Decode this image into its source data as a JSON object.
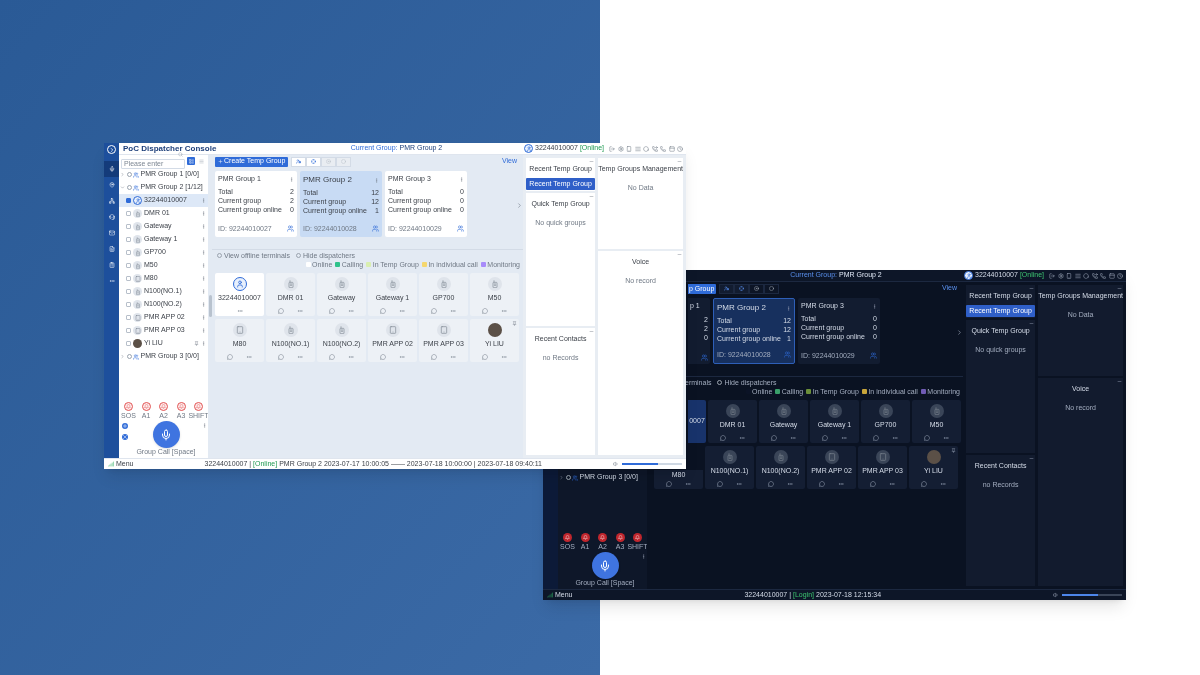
{
  "dark_window": {
    "current_group": {
      "label": "Current Group:",
      "value": "PMR Group 2"
    },
    "user": {
      "number": "32244010007",
      "status": "[Online]"
    },
    "sidebar": {
      "tree": [
        {
          "label": "PMR Group 3 [0/0]",
          "expanded": false,
          "checked": false
        }
      ],
      "emergency": [
        {
          "label": "SOS"
        },
        {
          "label": "A1"
        },
        {
          "label": "A2"
        },
        {
          "label": "A3"
        },
        {
          "label": "SHIFT"
        }
      ],
      "group_call": "Group Call [Space]"
    },
    "toolbar": {
      "create_button": {
        "label": "p Group",
        "kind": "partial"
      },
      "tools": [
        {
          "disabled": false
        },
        {
          "disabled": false
        },
        {
          "disabled": true
        },
        {
          "disabled": true
        }
      ],
      "view_link": "View"
    },
    "cards": [
      {
        "title": "p 1",
        "kind": "partial",
        "selected": false,
        "stats": [
          {
            "value": "2"
          },
          {
            "value": "2"
          },
          {
            "value": "0"
          }
        ]
      },
      {
        "title": "PMR Group 2",
        "kind": "full",
        "selected": true,
        "stats": [
          {
            "label": "Total",
            "value": "12"
          },
          {
            "label": "Current group",
            "value": "12"
          },
          {
            "label": "Current group online",
            "value": "1"
          }
        ],
        "id": "ID: 92244010028"
      },
      {
        "title": "PMR Group 3",
        "kind": "full",
        "selected": false,
        "stats": [
          {
            "label": "Total",
            "value": "0"
          },
          {
            "label": "Current group",
            "value": "0"
          },
          {
            "label": "Current group online",
            "value": "0"
          }
        ],
        "id": "ID: 92244010029"
      }
    ],
    "terminal_options": [
      {
        "label": "erminals",
        "kind": "partial"
      },
      {
        "label": "Hide dispatchers",
        "kind": "full",
        "checked": false
      }
    ],
    "legend": [
      {
        "label": "Online",
        "color": "#0b1326"
      },
      {
        "label": "Calling",
        "color": "#3aa06a"
      },
      {
        "label": "In Temp Group",
        "color": "#6b8f3a"
      },
      {
        "label": "In individual call",
        "color": "#c8a53a"
      },
      {
        "label": "Monitoring",
        "color": "#6f5bb5"
      }
    ],
    "terminals": [
      {
        "name": "0007",
        "kind": "partial",
        "selected": true,
        "pinned": false
      },
      {
        "name": "DMR 01",
        "kind": "radio",
        "selected": false,
        "pinned": false
      },
      {
        "name": "Gateway",
        "kind": "radio",
        "selected": false,
        "pinned": false
      },
      {
        "name": "Gateway 1",
        "kind": "radio",
        "selected": false,
        "pinned": false
      },
      {
        "name": "GP700",
        "kind": "radio",
        "selected": false,
        "pinned": false
      },
      {
        "name": "M50",
        "kind": "radio",
        "selected": false,
        "pinned": false
      },
      {
        "name": "M80",
        "kind": "lower",
        "selected": false,
        "pinned": false
      },
      {
        "name": "N100(NO.1)",
        "kind": "radio",
        "selected": false,
        "pinned": false
      },
      {
        "name": "N100(NO.2)",
        "kind": "radio",
        "selected": false,
        "pinned": false
      },
      {
        "name": "PMR APP 02",
        "kind": "phone",
        "selected": false,
        "pinned": false
      },
      {
        "name": "PMR APP 03",
        "kind": "phone",
        "selected": false,
        "pinned": false
      },
      {
        "name": "Yi LIU",
        "kind": "person",
        "selected": false,
        "pinned": true
      }
    ],
    "panels": {
      "left": [
        {
          "title": "Recent Temp Group",
          "button": "Recent Temp Group"
        },
        {
          "title": "Quick Temp Group",
          "empty": "No quick groups"
        },
        {
          "title": "Recent Contacts",
          "empty": "no Records"
        }
      ],
      "right": [
        {
          "title": "Temp Groups Management",
          "empty": "No Data"
        },
        {
          "title": "Voice",
          "empty": "No record"
        }
      ]
    },
    "status_bar": {
      "menu": "Menu",
      "number": "32244010007 |",
      "state": "[Login]",
      "text": "2023-07-18 12:15:34",
      "volume": {
        "level": 0.6
      }
    }
  },
  "light_window": {
    "app_title": "PoC Dispatcher Console",
    "current_group": {
      "label": "Current Group:",
      "value": "PMR Group 2"
    },
    "user": {
      "number": "32244010007",
      "status": "[Online]"
    },
    "nav_items": [
      {
        "selected": true
      },
      {
        "selected": false
      },
      {
        "selected": false
      },
      {
        "selected": false
      },
      {
        "selected": false
      },
      {
        "selected": false
      },
      {
        "selected": false
      },
      {
        "selected": false
      }
    ],
    "sidebar": {
      "search": {
        "placeholder": "Please enter"
      },
      "view_modes": [
        {
          "selected": true
        },
        {
          "selected": false
        }
      ],
      "tree": [
        {
          "label": "PMR Group 1 [0/0]",
          "expanded": false,
          "checked": false
        },
        {
          "label": "PMR Group 2 [1/12]",
          "expanded": true,
          "checked": false,
          "children": [
            {
              "label": "32244010007",
              "kind": "dispatcher",
              "checked": true,
              "selected": true,
              "pinned": false
            },
            {
              "label": "DMR 01",
              "kind": "radio",
              "checked": false,
              "selected": false,
              "pinned": false
            },
            {
              "label": "Gateway",
              "kind": "radio",
              "checked": false,
              "selected": false,
              "pinned": false
            },
            {
              "label": "Gateway 1",
              "kind": "radio",
              "checked": false,
              "selected": false,
              "pinned": false
            },
            {
              "label": "GP700",
              "kind": "radio",
              "checked": false,
              "selected": false,
              "pinned": false
            },
            {
              "label": "M50",
              "kind": "radio",
              "checked": false,
              "selected": false,
              "pinned": false
            },
            {
              "label": "M80",
              "kind": "phone",
              "checked": false,
              "selected": false,
              "pinned": false
            },
            {
              "label": "N100(NO.1)",
              "kind": "radio",
              "checked": false,
              "selected": false,
              "pinned": false
            },
            {
              "label": "N100(NO.2)",
              "kind": "radio",
              "checked": false,
              "selected": false,
              "pinned": false
            },
            {
              "label": "PMR APP 02",
              "kind": "phone",
              "checked": false,
              "selected": false,
              "pinned": false
            },
            {
              "label": "PMR APP 03",
              "kind": "phone",
              "checked": false,
              "selected": false,
              "pinned": false
            },
            {
              "label": "Yi LIU",
              "kind": "person",
              "checked": false,
              "selected": false,
              "pinned": true
            }
          ]
        },
        {
          "label": "PMR Group 3 [0/0]",
          "expanded": false,
          "checked": false
        }
      ],
      "emergency": [
        {
          "label": "SOS"
        },
        {
          "label": "A1"
        },
        {
          "label": "A2"
        },
        {
          "label": "A3"
        },
        {
          "label": "SHIFT"
        }
      ],
      "group_call": "Group Call [Space]"
    },
    "toolbar": {
      "create_button": {
        "label": "Create Temp Group",
        "kind": "full"
      },
      "tools": [
        {
          "disabled": false
        },
        {
          "disabled": false
        },
        {
          "disabled": true
        },
        {
          "disabled": true
        }
      ],
      "view_link": "View"
    },
    "cards": [
      {
        "title": "PMR Group 1",
        "kind": "full",
        "selected": false,
        "stats": [
          {
            "label": "Total",
            "value": "2"
          },
          {
            "label": "Current group",
            "value": "2"
          },
          {
            "label": "Current group online",
            "value": "0"
          }
        ],
        "id": "ID: 92244010027"
      },
      {
        "title": "PMR Group 2",
        "kind": "full",
        "selected": true,
        "stats": [
          {
            "label": "Total",
            "value": "12"
          },
          {
            "label": "Current group",
            "value": "12"
          },
          {
            "label": "Current group online",
            "value": "1"
          }
        ],
        "id": "ID: 92244010028"
      },
      {
        "title": "PMR Group 3",
        "kind": "full",
        "selected": false,
        "stats": [
          {
            "label": "Total",
            "value": "0"
          },
          {
            "label": "Current group",
            "value": "0"
          },
          {
            "label": "Current group online",
            "value": "0"
          }
        ],
        "id": "ID: 92244010029"
      }
    ],
    "terminal_options": [
      {
        "label": "View offline terminals",
        "kind": "full",
        "checked": false
      },
      {
        "label": "Hide dispatchers",
        "kind": "full",
        "checked": false
      }
    ],
    "legend": [
      {
        "label": "Online",
        "color": "#ffffff"
      },
      {
        "label": "Calling",
        "color": "#2fc28b"
      },
      {
        "label": "In Temp Group",
        "color": "#d9efb0"
      },
      {
        "label": "In individual call",
        "color": "#f5d76e"
      },
      {
        "label": "Monitoring",
        "color": "#a78bfa"
      }
    ],
    "terminals": [
      {
        "name": "32244010007",
        "kind": "dispatcher",
        "selected": true,
        "pinned": false
      },
      {
        "name": "DMR 01",
        "kind": "radio",
        "selected": false,
        "pinned": false
      },
      {
        "name": "Gateway",
        "kind": "radio",
        "selected": false,
        "pinned": false
      },
      {
        "name": "Gateway 1",
        "kind": "radio",
        "selected": false,
        "pinned": false
      },
      {
        "name": "GP700",
        "kind": "radio",
        "selected": false,
        "pinned": false
      },
      {
        "name": "M50",
        "kind": "radio",
        "selected": false,
        "pinned": false
      },
      {
        "name": "M80",
        "kind": "phone",
        "selected": false,
        "pinned": false
      },
      {
        "name": "N100(NO.1)",
        "kind": "radio",
        "selected": false,
        "pinned": false
      },
      {
        "name": "N100(NO.2)",
        "kind": "radio",
        "selected": false,
        "pinned": false
      },
      {
        "name": "PMR APP 02",
        "kind": "phone",
        "selected": false,
        "pinned": false
      },
      {
        "name": "PMR APP 03",
        "kind": "phone",
        "selected": false,
        "pinned": false
      },
      {
        "name": "Yi LIU",
        "kind": "person",
        "selected": false,
        "pinned": true
      }
    ],
    "panels": {
      "left": [
        {
          "title": "Recent Temp Group",
          "button": "Recent Temp Group"
        },
        {
          "title": "Quick Temp Group",
          "empty": "No quick groups"
        },
        {
          "title": "Recent Contacts",
          "empty": "no Records"
        }
      ],
      "right": [
        {
          "title": "Temp Groups Management",
          "empty": "No Data"
        },
        {
          "title": "Voice",
          "empty": "No record"
        }
      ]
    },
    "status_bar": {
      "menu": "Menu",
      "number": "32244010007 |",
      "state": "[Online]",
      "text": "PMR Group 2 2023-07-17 10:00:05 —— 2023-07-18 10:00:00 | 2023-07-18 09:40:11",
      "volume": {
        "level": 0.6
      }
    }
  }
}
